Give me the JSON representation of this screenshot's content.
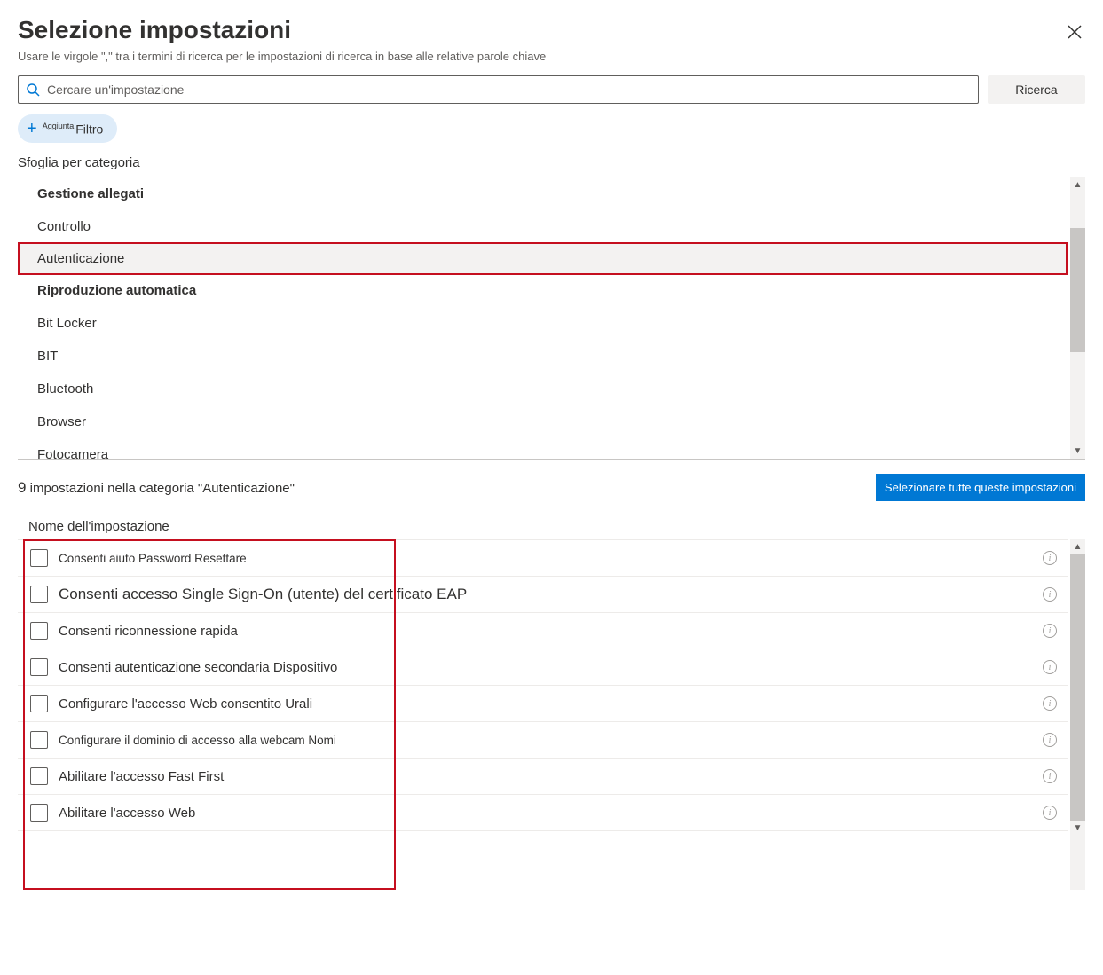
{
  "header": {
    "title": "Selezione impostazioni",
    "subtitle_before": "Usare le virgole ",
    "subtitle_quote": "\",\"",
    "subtitle_after": " tra i termini di ricerca per le impostazioni di ricerca in base alle relative parole chiave"
  },
  "search": {
    "placeholder": "Cercare un'impostazione",
    "button": "Ricerca"
  },
  "filter": {
    "sup": "Aggiunta",
    "label": "Filtro"
  },
  "browse_label": "Sfoglia per categoria",
  "categories": [
    {
      "label": "Gestione allegati",
      "bold": true,
      "selected": false
    },
    {
      "label": "Controllo",
      "bold": false,
      "selected": false
    },
    {
      "label": "Autenticazione",
      "bold": false,
      "selected": true
    },
    {
      "label": "Riproduzione automatica",
      "bold": true,
      "selected": false
    },
    {
      "label": "Bit Locker",
      "bold": false,
      "selected": false
    },
    {
      "label": "BIT",
      "bold": false,
      "selected": false
    },
    {
      "label": "Bluetooth",
      "bold": false,
      "selected": false
    },
    {
      "label": "Browser",
      "bold": false,
      "selected": false
    },
    {
      "label": "Fotocamera",
      "bold": false,
      "selected": false
    }
  ],
  "results": {
    "count": "9",
    "text": " impostazioni nella categoria \"Autenticazione\"",
    "select_all": "Selezionare tutte queste impostazioni"
  },
  "column_header": "Nome dell'impostazione",
  "settings": [
    {
      "label": "Consenti aiuto   Password   Resettare",
      "size": "small"
    },
    {
      "label": "Consenti accesso Single Sign-On (utente) del certificato EAP",
      "size": "large"
    },
    {
      "label": "Consenti riconnessione rapida",
      "size": "normal"
    },
    {
      "label": "Consenti autenticazione secondaria   Dispositivo",
      "size": "normal"
    },
    {
      "label": "Configurare l'accesso Web consentito   Urali",
      "size": "normal"
    },
    {
      "label": "Configurare il dominio di accesso alla webcam   Nomi",
      "size": "small"
    },
    {
      "label": "Abilitare l'accesso Fast First",
      "size": "normal"
    },
    {
      "label": "Abilitare l'accesso Web",
      "size": "normal"
    }
  ]
}
